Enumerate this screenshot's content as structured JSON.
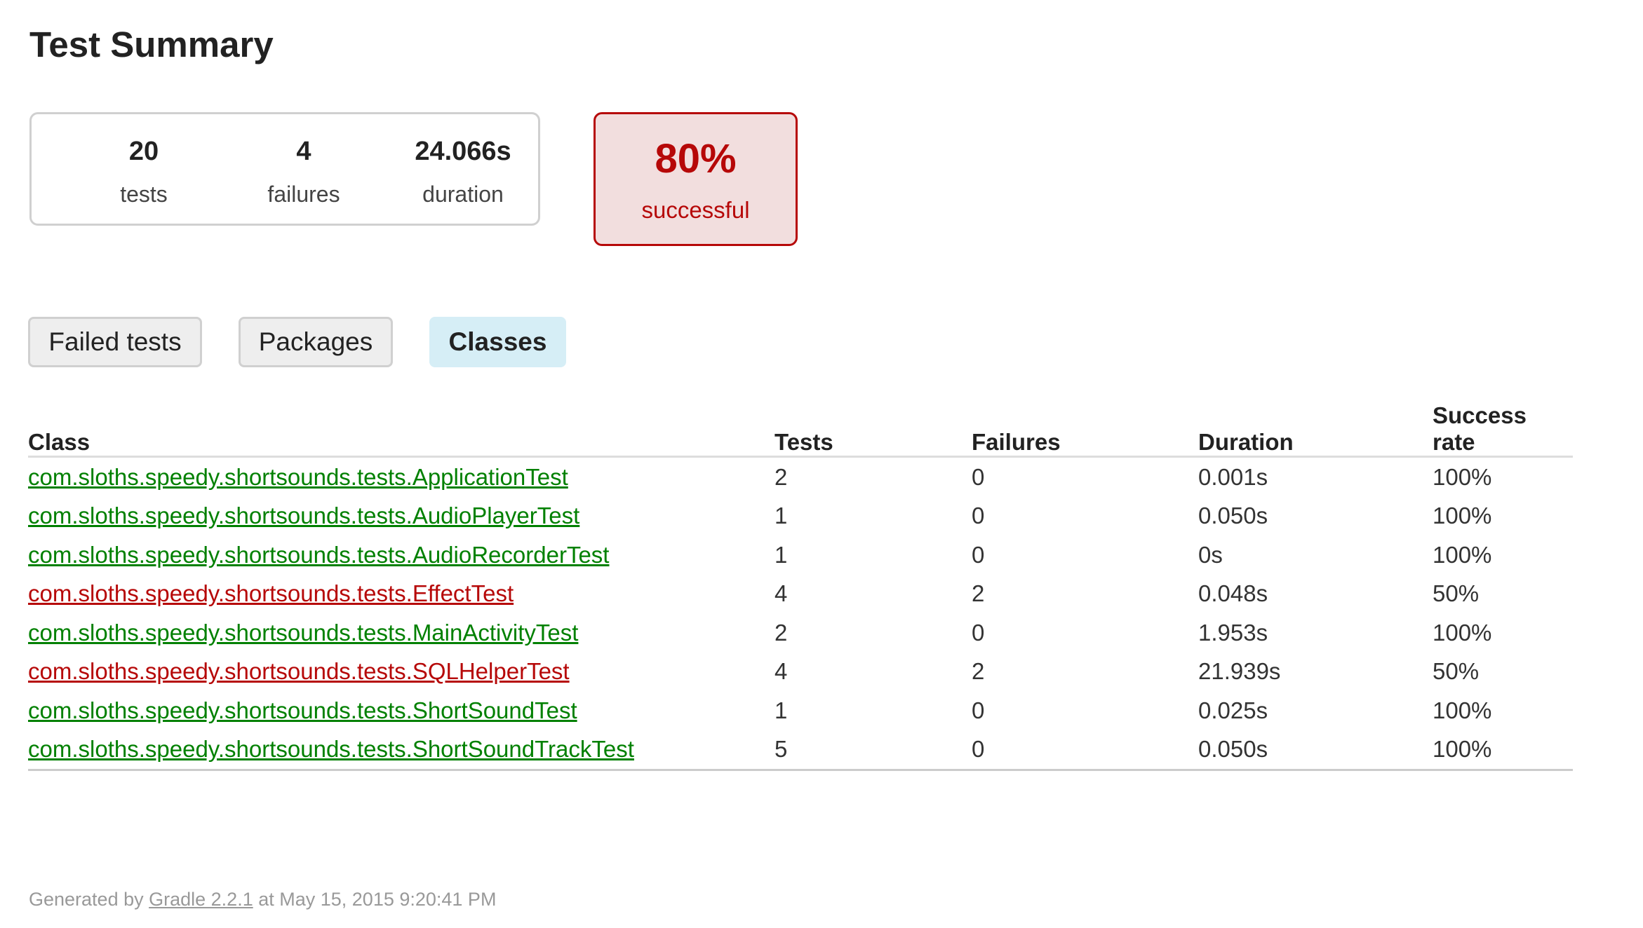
{
  "title": "Test Summary",
  "summary": {
    "tests": {
      "value": "20",
      "label": "tests"
    },
    "failures": {
      "value": "4",
      "label": "failures"
    },
    "duration": {
      "value": "24.066s",
      "label": "duration"
    },
    "success": {
      "value": "80%",
      "label": "successful"
    }
  },
  "tabs": [
    {
      "label": "Failed tests",
      "selected": false
    },
    {
      "label": "Packages",
      "selected": false
    },
    {
      "label": "Classes",
      "selected": true
    }
  ],
  "table": {
    "headers": [
      "Class",
      "Tests",
      "Failures",
      "Duration",
      "Success rate"
    ],
    "rows": [
      {
        "class": "com.sloths.speedy.shortsounds.tests.ApplicationTest",
        "tests": "2",
        "failures": "0",
        "duration": "0.001s",
        "success_rate": "100%",
        "status": "success"
      },
      {
        "class": "com.sloths.speedy.shortsounds.tests.AudioPlayerTest",
        "tests": "1",
        "failures": "0",
        "duration": "0.050s",
        "success_rate": "100%",
        "status": "success"
      },
      {
        "class": "com.sloths.speedy.shortsounds.tests.AudioRecorderTest",
        "tests": "1",
        "failures": "0",
        "duration": "0s",
        "success_rate": "100%",
        "status": "success"
      },
      {
        "class": "com.sloths.speedy.shortsounds.tests.EffectTest",
        "tests": "4",
        "failures": "2",
        "duration": "0.048s",
        "success_rate": "50%",
        "status": "failure"
      },
      {
        "class": "com.sloths.speedy.shortsounds.tests.MainActivityTest",
        "tests": "2",
        "failures": "0",
        "duration": "1.953s",
        "success_rate": "100%",
        "status": "success"
      },
      {
        "class": "com.sloths.speedy.shortsounds.tests.SQLHelperTest",
        "tests": "4",
        "failures": "2",
        "duration": "21.939s",
        "success_rate": "50%",
        "status": "failure"
      },
      {
        "class": "com.sloths.speedy.shortsounds.tests.ShortSoundTest",
        "tests": "1",
        "failures": "0",
        "duration": "0.025s",
        "success_rate": "100%",
        "status": "success"
      },
      {
        "class": "com.sloths.speedy.shortsounds.tests.ShortSoundTrackTest",
        "tests": "5",
        "failures": "0",
        "duration": "0.050s",
        "success_rate": "100%",
        "status": "success"
      }
    ]
  },
  "footer": {
    "prefix": "Generated by ",
    "link": "Gradle 2.2.1",
    "suffix": " at May 15, 2015 9:20:41 PM"
  },
  "colors": {
    "success": "#008000",
    "failure": "#b60808",
    "failure_background": "#f2dede",
    "selected_tab": "#d6eef6"
  }
}
